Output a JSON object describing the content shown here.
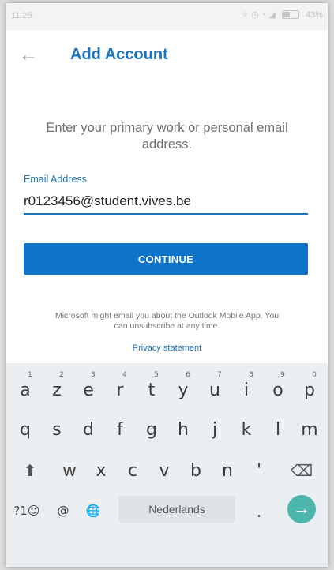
{
  "statusbar": {
    "time": "11:25",
    "icons": "✧ ◷ ◔ ◢",
    "battery_label": "43%"
  },
  "appbar": {
    "back_icon": "←",
    "title": "Add Account"
  },
  "form": {
    "intro": "Enter your primary work or personal email address.",
    "email_label": "Email Address",
    "email_value": "r0123456@student.vives.be",
    "continue_label": "CONTINUE",
    "disclaimer": "Microsoft might email you about the Outlook Mobile App. You can unsubscribe at any time.",
    "privacy_link": "Privacy statement"
  },
  "keyboard": {
    "row1": [
      {
        "key": "a",
        "hint": "1"
      },
      {
        "key": "z",
        "hint": "2"
      },
      {
        "key": "e",
        "hint": "3"
      },
      {
        "key": "r",
        "hint": "4"
      },
      {
        "key": "t",
        "hint": "5"
      },
      {
        "key": "y",
        "hint": "6"
      },
      {
        "key": "u",
        "hint": "7"
      },
      {
        "key": "i",
        "hint": "8"
      },
      {
        "key": "o",
        "hint": "9"
      },
      {
        "key": "p",
        "hint": "0"
      }
    ],
    "row2": [
      "q",
      "s",
      "d",
      "f",
      "g",
      "h",
      "j",
      "k",
      "l",
      "m"
    ],
    "row3": [
      "w",
      "x",
      "c",
      "v",
      "b",
      "n",
      "'"
    ],
    "shift_icon": "⬆",
    "backspace_icon": "⌫",
    "symbols_label": "?1☺",
    "at_label": "@",
    "globe_icon": "🌐",
    "space_label": "Nederlands",
    "period_label": ".",
    "enter_icon": "→",
    "accent_color": "#4db6ac"
  }
}
